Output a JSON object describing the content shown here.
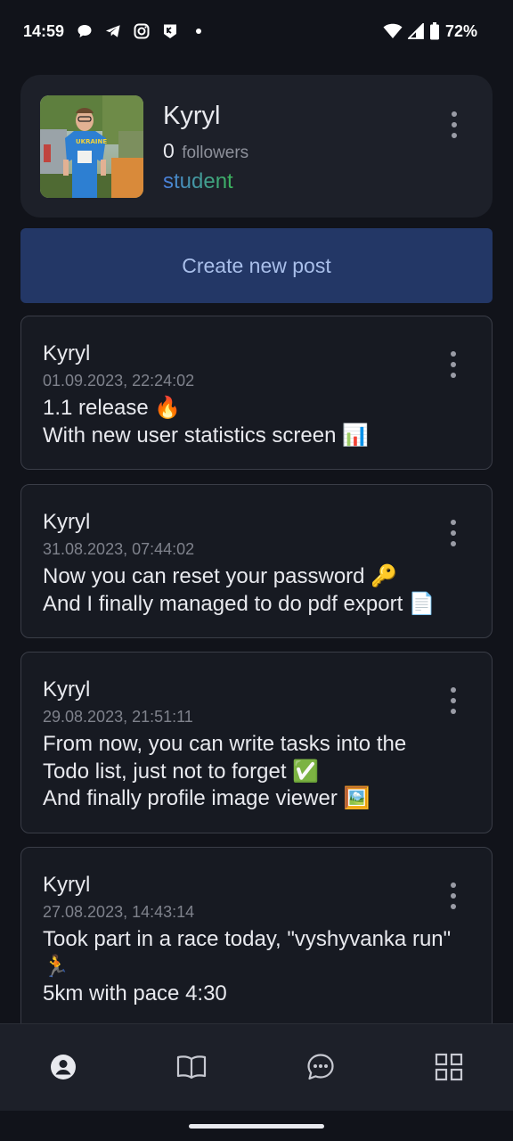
{
  "status_bar": {
    "time": "14:59",
    "battery": "72%",
    "icons": [
      "chat-bubble-icon",
      "telegram-icon",
      "instagram-icon",
      "app-shield-icon",
      "notification-dot-icon",
      "wifi-icon",
      "signal-icon",
      "battery-icon"
    ]
  },
  "profile": {
    "name": "Kyryl",
    "followers_count": "0",
    "followers_label": "followers",
    "role": "student",
    "menu_icon": "more-vertical-icon"
  },
  "create_post": {
    "label": "Create new post"
  },
  "posts": [
    {
      "author": "Kyryl",
      "date": "01.09.2023, 22:24:02",
      "lines": [
        "1.1 release 🔥",
        "With new user statistics screen 📊"
      ]
    },
    {
      "author": "Kyryl",
      "date": "31.08.2023, 07:44:02",
      "lines": [
        "Now you can reset your password 🔑",
        "And I finally managed to do pdf export 📄"
      ]
    },
    {
      "author": "Kyryl",
      "date": "29.08.2023, 21:51:11",
      "lines": [
        "From now, you can write tasks into the",
        "Todo list, just not to forget ✅",
        "And finally profile image viewer 🖼️"
      ]
    },
    {
      "author": "Kyryl",
      "date": "27.08.2023, 14:43:14",
      "lines": [
        "Took part in a race today, \"vyshyvanka run\"",
        "🏃",
        "5km with pace 4:30"
      ]
    }
  ],
  "bottom_nav": {
    "items": [
      "profile-icon",
      "book-icon",
      "chat-icon",
      "grid-icon"
    ]
  },
  "colors": {
    "background": "#11131a",
    "card": "#1d2029",
    "button": "#233766",
    "button_text": "#a9bfea",
    "role_gradient_start": "#4b7fe0",
    "role_gradient_end": "#3cb45a"
  }
}
